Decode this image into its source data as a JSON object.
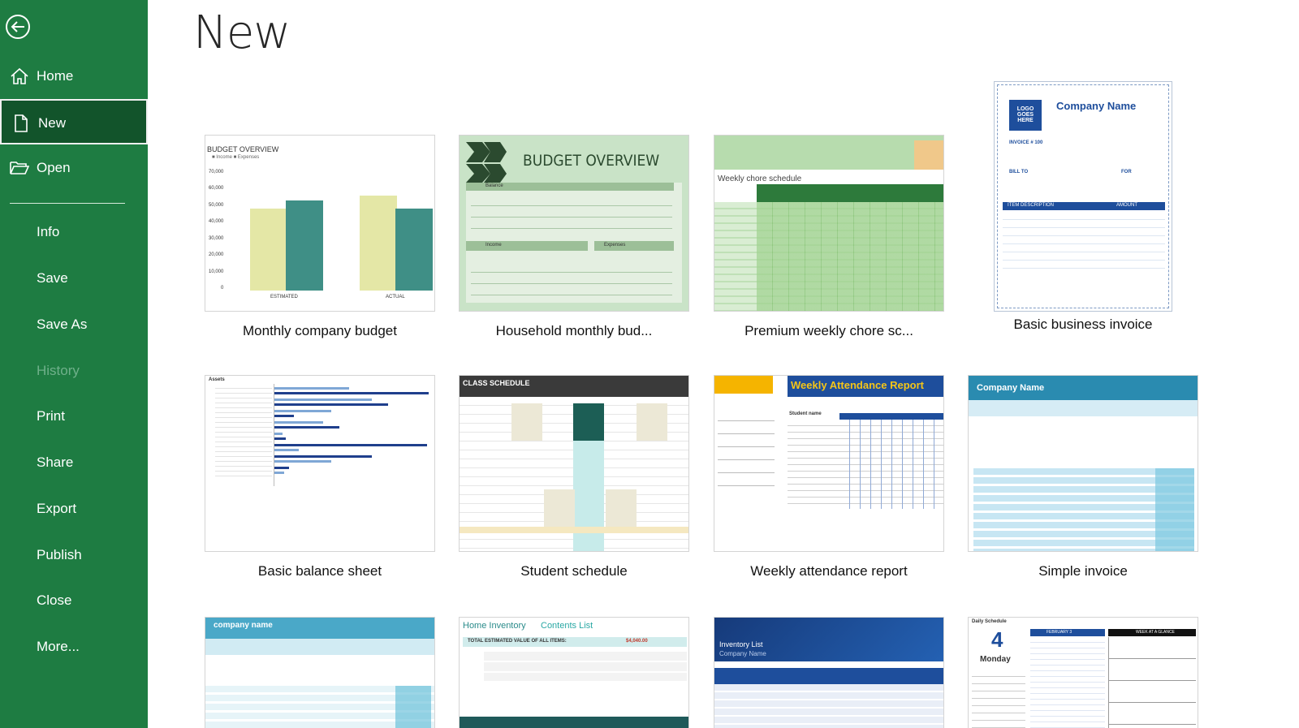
{
  "sidebar": {
    "back_label": "Back",
    "items": [
      {
        "label": "Home"
      },
      {
        "label": "New"
      },
      {
        "label": "Open"
      },
      {
        "label": "Info"
      },
      {
        "label": "Save"
      },
      {
        "label": "Save As"
      },
      {
        "label": "History"
      },
      {
        "label": "Print"
      },
      {
        "label": "Share"
      },
      {
        "label": "Export"
      },
      {
        "label": "Publish"
      },
      {
        "label": "Close"
      },
      {
        "label": "More..."
      }
    ]
  },
  "main": {
    "title": "New",
    "templates": [
      {
        "name": "Monthly company budget"
      },
      {
        "name": "Household monthly bud..."
      },
      {
        "name": "Premium weekly chore sc..."
      },
      {
        "name": "Basic business invoice"
      },
      {
        "name": "Basic balance sheet"
      },
      {
        "name": "Student schedule"
      },
      {
        "name": "Weekly attendance report"
      },
      {
        "name": "Simple invoice"
      }
    ],
    "thumb_text": {
      "budget_overview_small": "BUDGET OVERVIEW",
      "income_expenses": "■ Income ■ Expenses",
      "y_ticks": [
        "70,000",
        "60,000",
        "50,000",
        "40,000",
        "30,000",
        "20,000",
        "10,000",
        "0"
      ],
      "estimated": "ESTIMATED",
      "actual": "ACTUAL",
      "budget_overview_big": "BUDGET OVERVIEW",
      "balance": "Balance",
      "income": "Income",
      "expenses": "Expenses",
      "weekly_chore": "Weekly chore schedule",
      "logo_goes_here": "LOGO GOES HERE",
      "company_name": "Company Name",
      "invoice_no": "INVOICE # 100",
      "bill_to": "BILL TO",
      "for": "FOR",
      "item_description": "ITEM DESCRIPTION",
      "amount": "AMOUNT",
      "assets": "Assets",
      "class_schedule": "CLASS SCHEDULE",
      "weekly_attendance": "Weekly Attendance Report",
      "student_name": "Student name",
      "company_name_simple": "Company Name",
      "company_name_lower": "company name",
      "home_inventory": "Home Inventory",
      "contents_list": "Contents List",
      "total_estimated": "TOTAL ESTIMATED VALUE OF ALL ITEMS:",
      "total_value": "$4,040.00",
      "inventory_list": "Inventory List",
      "inventory_company": "Company Name",
      "daily_schedule": "Daily Schedule",
      "day_number": "4",
      "day_name": "Monday",
      "february": "FEBRUARY 3",
      "week_glance": "WEEK AT A GLANCE"
    },
    "colors": {
      "sidebar_green": "#1e7c42",
      "active_item": "#12542b",
      "teal": "#3f8f86",
      "pale_yellow": "#e4e7a6"
    }
  }
}
